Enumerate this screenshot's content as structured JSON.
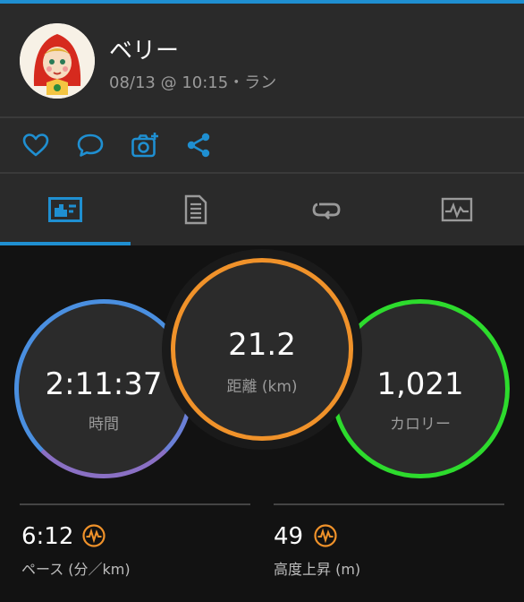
{
  "header": {
    "username": "ベリー",
    "subtitle": "08/13 @ 10:15・ラン"
  },
  "actions": {
    "icons": [
      "heart-icon",
      "comment-icon",
      "add-photo-icon",
      "share-icon"
    ]
  },
  "tabs": {
    "icons": [
      "overview-icon",
      "details-icon",
      "laps-icon",
      "chart-icon"
    ],
    "active_index": 0
  },
  "stats": {
    "time": {
      "value": "2:11:37",
      "label": "時間"
    },
    "distance": {
      "value": "21.2",
      "label": "距離 (km)"
    },
    "calories": {
      "value": "1,021",
      "label": "カロリー"
    }
  },
  "metrics": {
    "pace": {
      "value": "6:12",
      "label": "ペース (分／km)",
      "icon": "activity-icon"
    },
    "elevation": {
      "value": "49",
      "label": "高度上昇 (m)",
      "icon": "activity-icon"
    }
  },
  "colors": {
    "accent": "#1f8fd1",
    "time_ring": "#4a8fe0",
    "distance_ring": "#f0922a",
    "calories_ring": "#2ddb2d",
    "metric_icon": "#f0922a"
  }
}
